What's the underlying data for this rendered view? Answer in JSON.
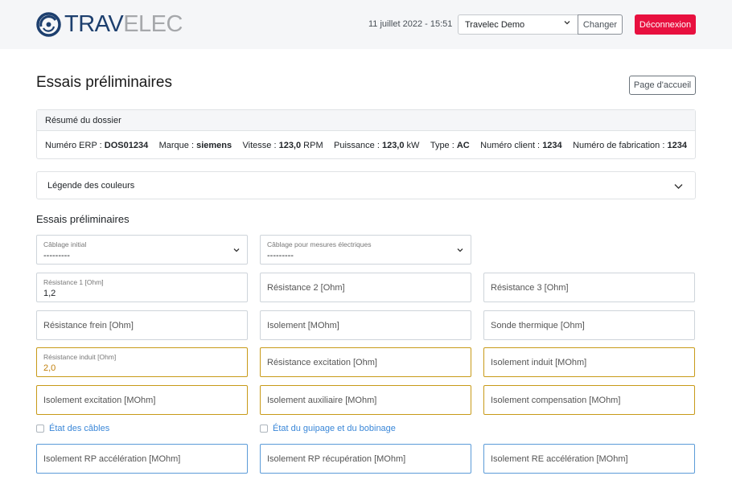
{
  "header": {
    "logo_part1": "TRAV",
    "logo_part2": "ELEC",
    "datetime": "11 juillet 2022 - 15:51",
    "company_select": "Travelec Demo",
    "change_label": "Changer",
    "logout_label": "Déconnexion",
    "colors": {
      "logo_blue": "#1d3f6e",
      "logo_grey": "#a6a8ab",
      "logout_red": "#e8103f"
    }
  },
  "page": {
    "title": "Essais préliminaires",
    "home_label": "Page d'accueil"
  },
  "summary": {
    "title": "Résumé du dossier",
    "erp_label": "Numéro ERP :",
    "erp_value": "DOS01234",
    "marque_label": "Marque :",
    "marque_value": "siemens",
    "vitesse_label": "Vitesse :",
    "vitesse_value": "123,0",
    "vitesse_unit": "RPM",
    "puissance_label": "Puissance :",
    "puissance_value": "123,0",
    "puissance_unit": "kW",
    "type_label": "Type :",
    "type_value": "AC",
    "client_label": "Numéro client :",
    "client_value": "1234",
    "fabrication_label": "Numéro de fabrication :",
    "fabrication_value": "1234"
  },
  "legend": {
    "label": "Légende des couleurs"
  },
  "section": {
    "title": "Essais préliminaires"
  },
  "fields": {
    "cablage_initial": {
      "label": "Câblage initial",
      "value": "---------"
    },
    "cablage_mesures": {
      "label": "Câblage pour mesures électriques",
      "value": "---------"
    },
    "resistance1": {
      "label": "Résistance 1 [Ohm]",
      "value": "1,2"
    },
    "resistance2": {
      "placeholder": "Résistance 2 [Ohm]"
    },
    "resistance3": {
      "placeholder": "Résistance 3 [Ohm]"
    },
    "resistance_frein": {
      "placeholder": "Résistance frein [Ohm]"
    },
    "isolement": {
      "placeholder": "Isolement [MOhm]"
    },
    "sonde_thermique": {
      "placeholder": "Sonde thermique [Ohm]"
    },
    "resistance_induit": {
      "label": "Résistance induit [Ohm]",
      "value": "2,0"
    },
    "resistance_excitation": {
      "placeholder": "Résistance excitation [Ohm]"
    },
    "isolement_induit": {
      "placeholder": "Isolement induit [MOhm]"
    },
    "isolement_excitation": {
      "placeholder": "Isolement excitation [MOhm]"
    },
    "isolement_auxiliaire": {
      "placeholder": "Isolement auxiliaire [MOhm]"
    },
    "isolement_compensation": {
      "placeholder": "Isolement compensation [MOhm]"
    },
    "isolement_rp_acceleration": {
      "placeholder": "Isolement RP accélération [MOhm]"
    },
    "isolement_rp_recuperation": {
      "placeholder": "Isolement RP récupération [MOhm]"
    },
    "isolement_re_acceleration": {
      "placeholder": "Isolement RE accélération [MOhm]"
    }
  },
  "checks": {
    "etat_cables": "État des câbles",
    "etat_guipage": "État du guipage et du bobinage"
  },
  "colors": {
    "warn_border": "#c89a18",
    "info_border": "#5b9bd8",
    "link_blue": "#3a87d8"
  }
}
